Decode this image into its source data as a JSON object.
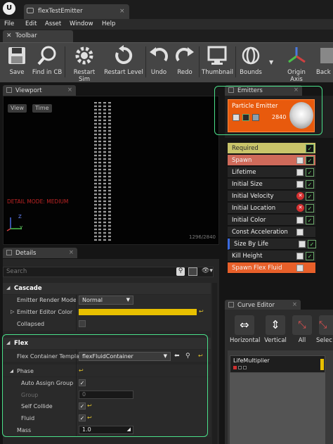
{
  "window": {
    "tab_title": "flexTestEmitter",
    "close": "×"
  },
  "menu": [
    "File",
    "Edit",
    "Asset",
    "Window",
    "Help"
  ],
  "toolbar_tab": {
    "label": "Toolbar"
  },
  "toolbar": [
    {
      "label": "Save",
      "icon": "save-icon"
    },
    {
      "label": "Find in CB",
      "icon": "magnify-icon"
    },
    {
      "label": "Restart Sim",
      "icon": "gear-restart-icon"
    },
    {
      "label": "Restart Level",
      "icon": "restart-icon"
    },
    {
      "label": "Undo",
      "icon": "undo-icon"
    },
    {
      "label": "Redo",
      "icon": "redo-icon"
    },
    {
      "label": "Thumbnail",
      "icon": "monitor-icon"
    },
    {
      "label": "Bounds",
      "icon": "bounds-icon"
    },
    {
      "label": "Origin Axis",
      "icon": "axis-icon"
    },
    {
      "label": "Back",
      "icon": "background-icon"
    }
  ],
  "viewport": {
    "tab": "Viewport",
    "view_btn": "View",
    "time_btn": "Time",
    "mode_text": "DETAIL MODE: MEDIUM",
    "coords": "1296/2840",
    "axis_z": "Z",
    "axis_y": "Y"
  },
  "emitters": {
    "tab": "Emitters",
    "name": "Particle Emitter",
    "count": "2840"
  },
  "modules": [
    {
      "label": "Required",
      "style": "required",
      "checks": [
        "green"
      ]
    },
    {
      "label": "Spawn",
      "style": "spawn",
      "checks": [
        "white",
        "green"
      ]
    },
    {
      "label": "Lifetime",
      "style": "normal",
      "checks": [
        "white",
        "green"
      ]
    },
    {
      "label": "Initial Size",
      "style": "normal",
      "checks": [
        "white",
        "green"
      ]
    },
    {
      "label": "Initial Velocity",
      "style": "normal",
      "checks": [
        "red",
        "green"
      ]
    },
    {
      "label": "Initial Location",
      "style": "normal",
      "checks": [
        "red",
        "green"
      ]
    },
    {
      "label": "Initial Color",
      "style": "normal",
      "checks": [
        "white",
        "green"
      ]
    },
    {
      "label": "Const Acceleration",
      "style": "normal",
      "checks": [
        "white"
      ]
    },
    {
      "label": "Size By Life",
      "style": "blue",
      "checks": [
        "white",
        "green"
      ]
    },
    {
      "label": "Kill Height",
      "style": "normal",
      "checks": [
        "white",
        "green"
      ]
    },
    {
      "label": "Spawn Flex Fluid",
      "style": "spawnflex",
      "checks": [
        "white"
      ]
    }
  ],
  "details": {
    "tab": "Details",
    "search_placeholder": "Search",
    "cascade": {
      "title": "Cascade",
      "render_mode_label": "Emitter Render Mode",
      "render_mode_value": "Normal",
      "editor_color_label": "Emitter Editor Color",
      "collapsed_label": "Collapsed"
    },
    "flex": {
      "title": "Flex",
      "container_label": "Flex Container Templat",
      "container_value": "flexFluidContainer",
      "phase_label": "Phase",
      "auto_assign_label": "Auto Assign Group",
      "group_label": "Group",
      "group_value": "0",
      "self_collide_label": "Self Collide",
      "fluid_label": "Fluid",
      "mass_label": "Mass",
      "mass_value": "1.0"
    }
  },
  "curve_editor": {
    "tab": "Curve Editor",
    "buttons": [
      "Horizontal",
      "Vertical",
      "All",
      "Selec"
    ],
    "track": "LifeMultiplier"
  },
  "colors": {
    "accent_orange": "#e85a0d",
    "highlight_green": "#4ae08a",
    "required_yellow": "#c9c46a",
    "spawn_red": "#cf6a5a",
    "check_green": "#6ddc6d"
  }
}
